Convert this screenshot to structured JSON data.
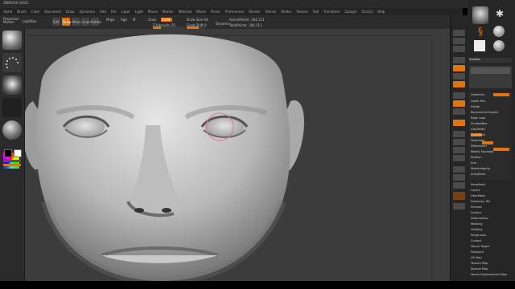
{
  "app": {
    "title": "ZBRUSH 2021"
  },
  "menu": [
    "Alpha",
    "Brush",
    "Color",
    "Document",
    "Draw",
    "Dynamics",
    "Edit",
    "File",
    "Layer",
    "Light",
    "Macro",
    "Marker",
    "Material",
    "Movie",
    "Picker",
    "Preferences",
    "Render",
    "Stencil",
    "Stroke",
    "Texture",
    "Tool",
    "Transform",
    "Zplugin",
    "Zscript",
    "Help"
  ],
  "shelf": {
    "labels": [
      "Projection Master",
      "LightBox",
      "Edit",
      "Draw",
      "Move",
      "Scale",
      "Rotate",
      "Mrgb",
      "Rgb",
      "M",
      "Zadd",
      "Zsub",
      "Z Intensity 25",
      "Focal Shift 0",
      "Draw Size 64",
      "Dynamic",
      "ActivePoints: 184,111",
      "TotalPoints: 184,111"
    ],
    "z_intensity": 0.25,
    "draw_size": 0.64
  },
  "viewport": {
    "subject": "head-mesh"
  },
  "colors": {
    "accent": "#e07410",
    "panel": "#2b2b2b",
    "viewport": "#3c3c3c"
  },
  "trays": {
    "subtool": "SubTool",
    "items": [
      "Geometry",
      "Lower Res",
      "Higher Res",
      "Divide",
      "Smt",
      "Suv",
      "Del Lower",
      "Del Higher",
      "Reconstruct Subdiv",
      "Freeze SubDivision Levels",
      "Edge Loop",
      "Crease",
      "ShadowBox",
      "ClayPolish",
      "DynaMesh",
      "Tessimate",
      "ZRemesher",
      "Modify Topology",
      "Position",
      "Size",
      "MeshIntegrity",
      "ArrayMesh",
      "NanoMesh",
      "Layers",
      "FiberMesh",
      "Geometry HD",
      "Preview",
      "Surface",
      "Deformation",
      "Masking",
      "Visibility",
      "Polygroups",
      "Contact",
      "Morph Target",
      "Polypaint",
      "UV Map",
      "Texture Map",
      "Displacement Map",
      "Normal Map",
      "Vector Displacement Map",
      "Display Properties"
    ]
  }
}
